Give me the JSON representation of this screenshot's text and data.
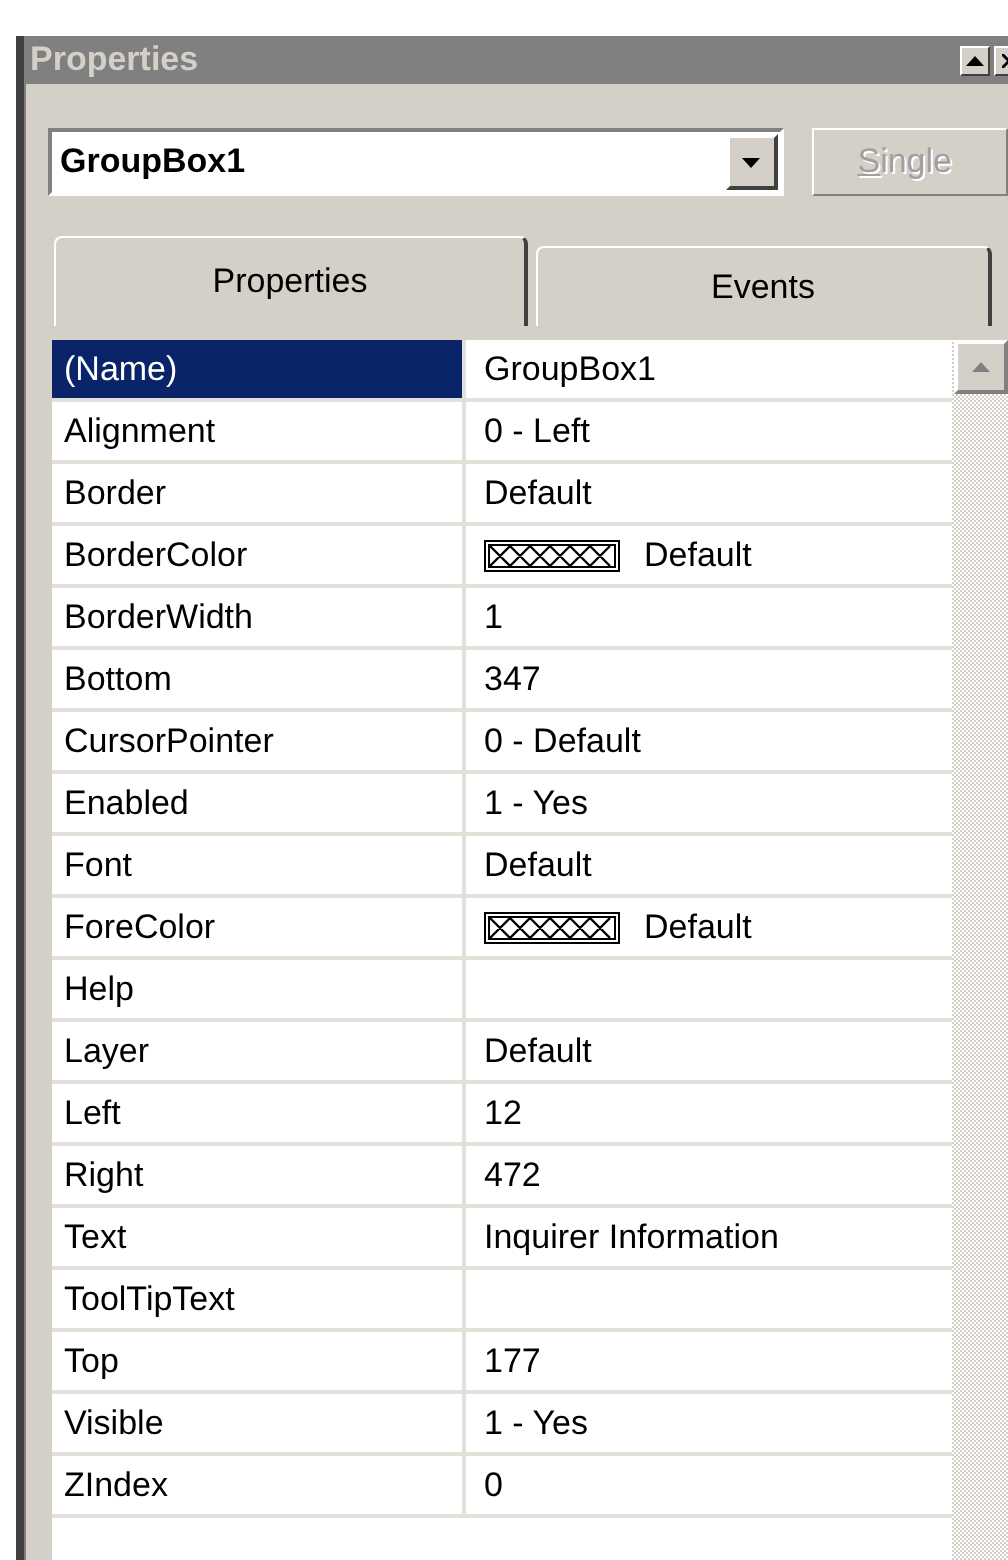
{
  "window": {
    "title": "Properties"
  },
  "object_selector": {
    "value": "GroupBox1"
  },
  "single_button": {
    "label": "Single",
    "disabled": true
  },
  "tabs": [
    {
      "label": "Properties",
      "selected": true
    },
    {
      "label": "Events",
      "selected": false
    }
  ],
  "properties": [
    {
      "name": "(Name)",
      "value": "GroupBox1",
      "kind": "text",
      "selected": true
    },
    {
      "name": "Alignment",
      "value": "0 - Left",
      "kind": "text",
      "selected": false
    },
    {
      "name": "Border",
      "value": "Default",
      "kind": "text",
      "selected": false
    },
    {
      "name": "BorderColor",
      "value": "Default",
      "kind": "color",
      "selected": false
    },
    {
      "name": "BorderWidth",
      "value": "1",
      "kind": "text",
      "selected": false
    },
    {
      "name": "Bottom",
      "value": "347",
      "kind": "text",
      "selected": false
    },
    {
      "name": "CursorPointer",
      "value": "0 - Default",
      "kind": "text",
      "selected": false
    },
    {
      "name": "Enabled",
      "value": "1 - Yes",
      "kind": "text",
      "selected": false
    },
    {
      "name": "Font",
      "value": "Default",
      "kind": "text",
      "selected": false
    },
    {
      "name": "ForeColor",
      "value": "Default",
      "kind": "color",
      "selected": false
    },
    {
      "name": "Help",
      "kind": "text",
      "selected": false
    },
    {
      "name": "Layer",
      "value": "Default",
      "kind": "text",
      "selected": false
    },
    {
      "name": "Left",
      "value": "12",
      "kind": "text",
      "selected": false
    },
    {
      "name": "Right",
      "value": "472",
      "kind": "text",
      "selected": false
    },
    {
      "name": "Text",
      "value": "Inquirer Information",
      "kind": "text",
      "selected": false
    },
    {
      "name": "ToolTipText",
      "kind": "text",
      "selected": false
    },
    {
      "name": "Top",
      "value": "177",
      "kind": "text",
      "selected": false
    },
    {
      "name": "Visible",
      "value": "1 - Yes",
      "kind": "text",
      "selected": false
    },
    {
      "name": "ZIndex",
      "value": "0",
      "kind": "text",
      "selected": false
    }
  ]
}
